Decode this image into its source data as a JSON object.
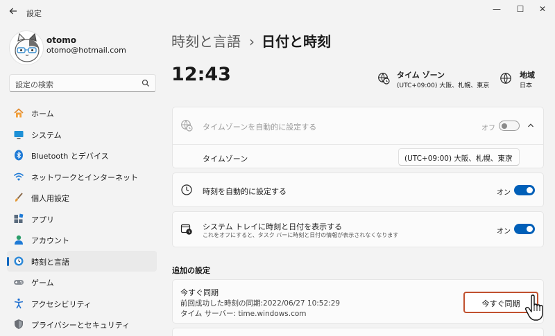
{
  "window": {
    "title": "設定",
    "back_icon": "arrow-left-icon",
    "minimize_glyph": "—",
    "maximize_glyph": "☐",
    "close_glyph": "✕"
  },
  "profile": {
    "name": "otomo",
    "email": "otomo@hotmail.com"
  },
  "search": {
    "placeholder": "設定の検索"
  },
  "sidebar": {
    "items": [
      {
        "label": "ホーム",
        "icon": "home-icon"
      },
      {
        "label": "システム",
        "icon": "monitor-icon"
      },
      {
        "label": "Bluetooth とデバイス",
        "icon": "bluetooth-icon"
      },
      {
        "label": "ネットワークとインターネット",
        "icon": "wifi-icon"
      },
      {
        "label": "個人用設定",
        "icon": "brush-icon"
      },
      {
        "label": "アプリ",
        "icon": "apps-icon"
      },
      {
        "label": "アカウント",
        "icon": "person-icon"
      },
      {
        "label": "時刻と言語",
        "icon": "globe-clock-icon",
        "active": true
      },
      {
        "label": "ゲーム",
        "icon": "gamepad-icon"
      },
      {
        "label": "アクセシビリティ",
        "icon": "accessibility-icon"
      },
      {
        "label": "プライバシーとセキュリティ",
        "icon": "shield-icon"
      }
    ]
  },
  "header": {
    "parent": "時刻と言語",
    "separator": "›",
    "current": "日付と時刻"
  },
  "summary": {
    "time": "12:43",
    "timezone_title": "タイム ゾーン",
    "timezone_value": "(UTC+09:00) 大阪、札幌、東京",
    "region_title": "地域",
    "region_value": "日本"
  },
  "settings": {
    "auto_timezone": {
      "label": "タイムゾーンを自動的に設定する",
      "state": "オフ",
      "enabled": false
    },
    "timezone": {
      "label": "タイムゾーン",
      "value": "(UTC+09:00) 大阪、札幌、東京"
    },
    "auto_time": {
      "label": "時刻を自動的に設定する",
      "state": "オン",
      "enabled": true
    },
    "tray": {
      "label": "システム トレイに時刻と日付を表示する",
      "description": "これをオフにすると、タスク バーに時刻と日付の情報が表示されなくなります",
      "state": "オン",
      "enabled": true
    }
  },
  "additional": {
    "title": "追加の設定",
    "sync_title": "今すぐ同期",
    "last_sync": "前回成功した時刻の同期:2022/06/27 10:52:29",
    "time_server": "タイム サーバー: time.windows.com",
    "sync_button": "今すぐ同期"
  },
  "colors": {
    "accent": "#005fb8",
    "highlight_border": "#c0502e",
    "background": "#f3f3f3",
    "card": "#fbfbfb"
  }
}
